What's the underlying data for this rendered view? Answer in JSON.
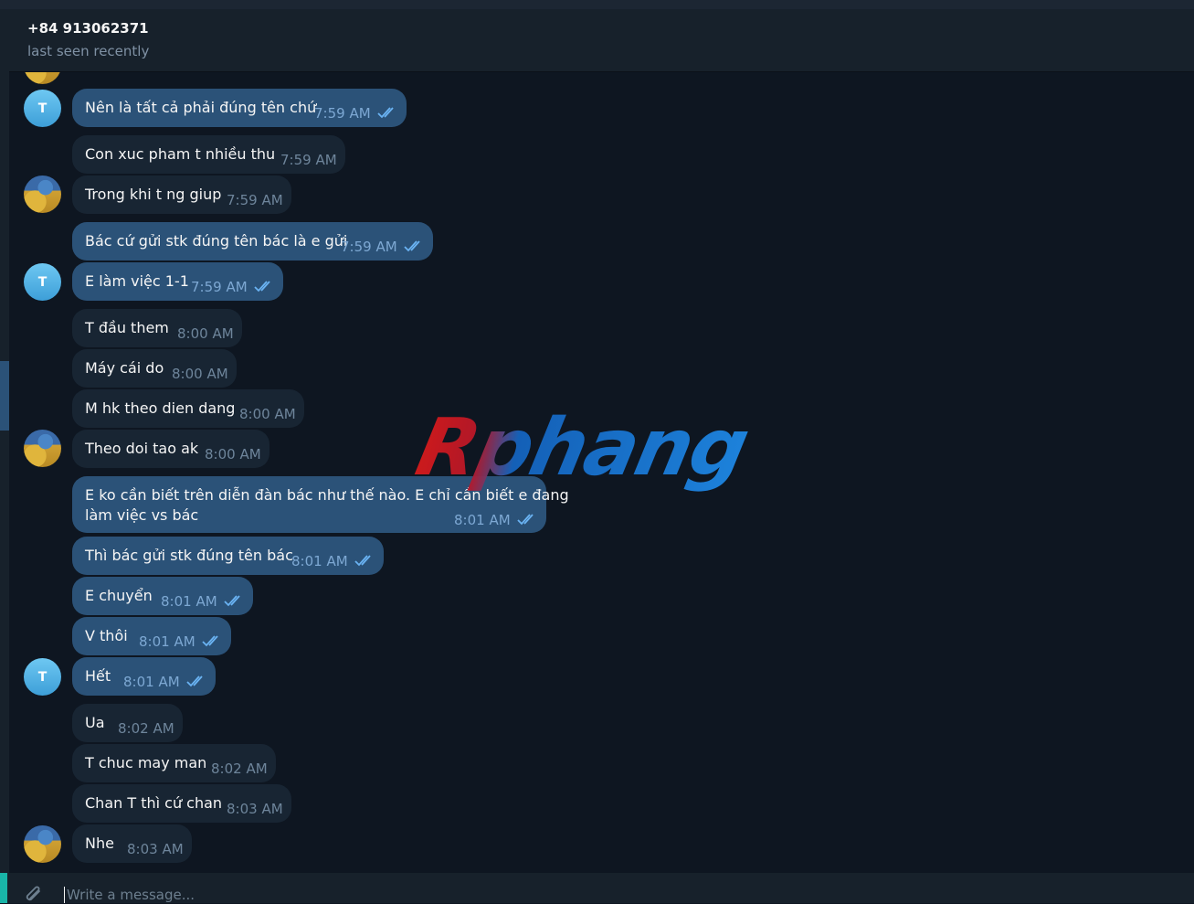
{
  "header": {
    "title": "+84 913062371",
    "status": "last seen recently"
  },
  "messages": [
    {
      "text": "Nên là tất cả phải đúng tên chứ",
      "time": "7:59 AM",
      "out": true
    },
    {
      "text": "Con xuc pham t  nhiều thu",
      "time": "7:59 AM",
      "out": false
    },
    {
      "text": "Trong khi t ng giup",
      "time": "7:59 AM",
      "out": false
    },
    {
      "text": "Bác cứ gửi stk đúng tên bác là e gửi",
      "time": "7:59 AM",
      "out": true
    },
    {
      "text": "E làm việc 1-1",
      "time": "7:59 AM",
      "out": true
    },
    {
      "text": "T đầu them",
      "time": "8:00 AM",
      "out": false
    },
    {
      "text": "Máy cái do",
      "time": "8:00 AM",
      "out": false
    },
    {
      "text": "M hk theo dien dang",
      "time": "8:00 AM",
      "out": false
    },
    {
      "text": "Theo doi tao ak",
      "time": "8:00 AM",
      "out": false
    },
    {
      "text": "E ko cần biết trên diễn đàn bác như thế nào. E chỉ cần biết e đang",
      "text2": "làm việc vs bác",
      "time": "8:01 AM",
      "out": true
    },
    {
      "text": "Thì bác gửi stk đúng tên bác",
      "time": "8:01 AM",
      "out": true
    },
    {
      "text": "E chuyển",
      "time": "8:01 AM",
      "out": true
    },
    {
      "text": "V thôi",
      "time": "8:01 AM",
      "out": true
    },
    {
      "text": "Hết",
      "time": "8:01 AM",
      "out": true
    },
    {
      "text": "Ua",
      "time": "8:02 AM",
      "out": false
    },
    {
      "text": "T chuc may man",
      "time": "8:02 AM",
      "out": false
    },
    {
      "text": "Chan T thì cứ chan",
      "time": "8:03 AM",
      "out": false
    },
    {
      "text": "Nhe",
      "time": "8:03 AM",
      "out": false
    }
  ],
  "avatars": {
    "letter": "T"
  },
  "composer": {
    "placeholder": "Write a message..."
  },
  "watermark": "Rphang",
  "colors": {
    "background": "#0e1621",
    "incoming": "#182533",
    "outgoing": "#2b5278",
    "accent": "#19b5a8"
  }
}
